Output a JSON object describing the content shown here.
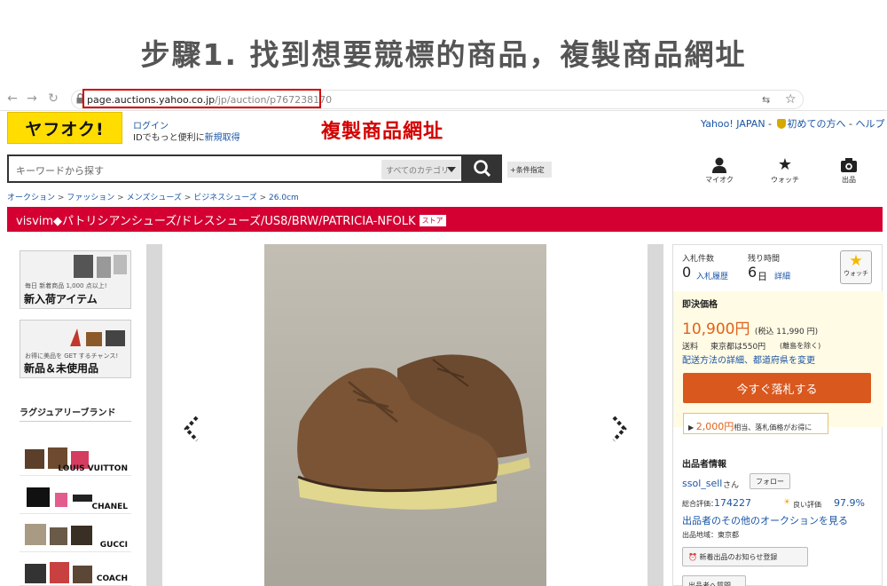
{
  "heading": "步驟1. 找到想要競標的商品，複製商品網址",
  "browser": {
    "url_host": "page.auctions.yahoo.co.jp",
    "url_path": "/jp/auction/p767238170"
  },
  "header": {
    "logo": "ヤフオク!",
    "login": "ログイン",
    "login_sub_prefix": "IDでもっと便利に",
    "login_sub_link": "新規取得",
    "annotation": "複製商品網址",
    "links": [
      "Yahoo! JAPAN",
      "初めての方へ",
      "ヘルプ"
    ]
  },
  "search": {
    "placeholder": "キーワードから探す",
    "category": "すべてのカテゴリ",
    "conditions": "+条件指定"
  },
  "tools": [
    {
      "label": "マイオク",
      "icon": "user-icon"
    },
    {
      "label": "ウォッチ",
      "icon": "star-icon"
    },
    {
      "label": "出品",
      "icon": "camera-icon"
    }
  ],
  "breadcrumb": [
    "オークション",
    "ファッション",
    "メンズシューズ",
    "ビジネスシューズ",
    "26.0cm"
  ],
  "product_title": "visvim◆パトリシアンシューズ/ドレスシューズ/US8/BRW/PATRICIA-NFOLK",
  "store_badge": "ストア",
  "left": {
    "banner1_small": "毎日 新着商品 1,000 点以上!",
    "banner1_title": "新入荷アイテム",
    "banner2_small": "お得に美品を GET するチャンス!",
    "banner2_title": "新品＆未使用品",
    "brand_heading": "ラグジュアリーブランド",
    "brands": [
      "LOUIS VUITTON",
      "CHANEL",
      "GUCCI",
      "COACH"
    ]
  },
  "panel": {
    "bids_label": "入札件数",
    "bids_value": "0",
    "bids_link": "入札履歴",
    "time_label": "残り時間",
    "time_value": "6",
    "time_unit": "日",
    "time_link": "詳細",
    "watch_label": "ウォッチ",
    "buyout_label": "即決価格",
    "price": "10,900円",
    "price_tax": "(税込 11,990 円)",
    "shipping_label": "送料",
    "shipping_text": "東京都は550円",
    "shipping_note": "(離島を除く)",
    "shipping_link": "配送方法の詳細、都道府県を変更",
    "buy_button": "今すぐ落札する",
    "tip_price": "2,000円",
    "tip_text": "相当、落札価格がお得に",
    "seller_heading": "出品者情報",
    "seller_name": "ssol_sell",
    "seller_suffix": "さん",
    "follow": "フォロー",
    "rating_label": "総合評価：",
    "rating_value": "174227",
    "good_label": "良い評価",
    "good_value": "97.9%",
    "other_auctions": "出品者のその他のオークションを見る",
    "region": "出品地域：東京都",
    "notify_button": "新着出品のお知らせ登録",
    "question_button": "出品者へ質問"
  },
  "colors": {
    "accent_red": "#d40032",
    "annotation_red": "#d40000",
    "price_orange": "#e0621a",
    "logo_yellow": "#ffdd00"
  }
}
